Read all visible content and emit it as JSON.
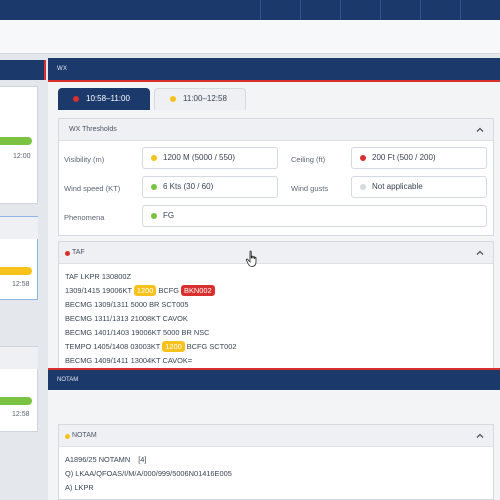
{
  "left": {
    "times": [
      "12:00",
      "12:58",
      "12:58"
    ]
  },
  "wx": {
    "title": "WX",
    "tabs": [
      {
        "label": "10:58–11:00",
        "dot_color": "#d9302f",
        "active": true
      },
      {
        "label": "11:00–12:58",
        "dot_color": "#f7c21b",
        "active": false
      }
    ],
    "thresholds": {
      "title": "WX Thresholds",
      "fields": {
        "visibility": {
          "label": "Visibility (m)",
          "value": "1200 M (5000 / 550)",
          "dot_color": "#f7c21b"
        },
        "ceiling": {
          "label": "Ceiling (ft)",
          "value": "200 Ft (500 / 200)",
          "dot_color": "#d9302f"
        },
        "wind_speed": {
          "label": "Wind speed (KT)",
          "value": "6 Kts (30 / 60)",
          "dot_color": "#7cc242"
        },
        "wind_gusts": {
          "label": "Wind gusts",
          "value": "Not applicable",
          "dot_color": "#d5d9e0"
        },
        "phenomena": {
          "label": "Phenomena",
          "value": "FG",
          "dot_color": "#7cc242"
        }
      }
    },
    "taf": {
      "title": "TAF",
      "line1": "TAF LKPR 130800Z",
      "line2_pre": "1309/1415 19006KT",
      "line2_badge1": "1200",
      "line2_mid": "BCFG",
      "line2_badge2": "BKN002",
      "line3": "BECMG 1309/1311 5000 BR SCT005",
      "line4": "BECMG 1311/1313 21008KT CAVOK",
      "line5": "BECMG 1401/1403 19006KT 5000 BR NSC",
      "line6_pre": "TEMPO 1405/1408 03003KT",
      "line6_badge": "1200",
      "line6_post": "BCFG SCT002",
      "line7": "BECMG 1409/1411 13004KT CAVOK="
    }
  },
  "notam": {
    "header": "NOTAM",
    "section_title": "NOTAM",
    "line1": "A1896/25 NOTAMN",
    "line1_count": "[4]",
    "line2": "Q) LKAA/QFOAS/I/M/A/000/999/5006N01416E005",
    "line3": "A) LKPR"
  }
}
